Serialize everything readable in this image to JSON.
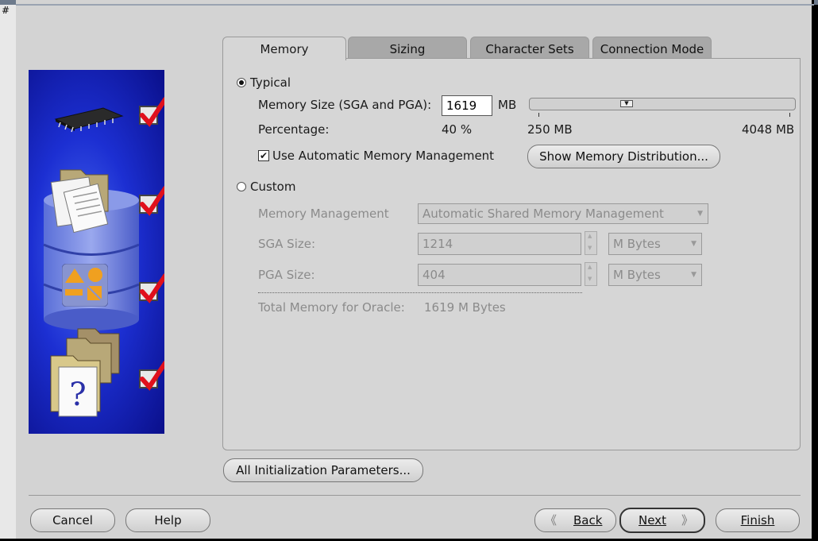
{
  "tabs": [
    "Memory",
    "Sizing",
    "Character Sets",
    "Connection Mode"
  ],
  "typical": {
    "label": "Typical",
    "selected": true,
    "memory_size_label": "Memory Size (SGA and PGA):",
    "memory_size_value": "1619",
    "memory_unit": "MB",
    "percentage_label": "Percentage:",
    "percentage_value": "40 %",
    "slider_min": "250 MB",
    "slider_max": "4048 MB",
    "amm_label": "Use Automatic Memory Management",
    "amm_checked": "✔",
    "show_dist_button": "Show Memory Distribution..."
  },
  "custom": {
    "label": "Custom",
    "selected": false,
    "memory_management_label": "Memory Management",
    "memory_management_value": "Automatic Shared Memory Management",
    "sga_label": "SGA Size:",
    "sga_value": "1214",
    "sga_unit": "M Bytes",
    "pga_label": "PGA Size:",
    "pga_value": "404",
    "pga_unit": "M Bytes",
    "total_label": "Total Memory for Oracle:",
    "total_value": "1619 M Bytes"
  },
  "init_params_button": "All Initialization Parameters...",
  "footer": {
    "cancel": "Cancel",
    "help": "Help",
    "back": "Back",
    "next": "Next",
    "finish": "Finish"
  },
  "corner_mark": "#",
  "colors": {
    "panel_blue": "#1c2fd2",
    "check_red": "#e0101c",
    "window_gray": "#d3d3d3"
  }
}
